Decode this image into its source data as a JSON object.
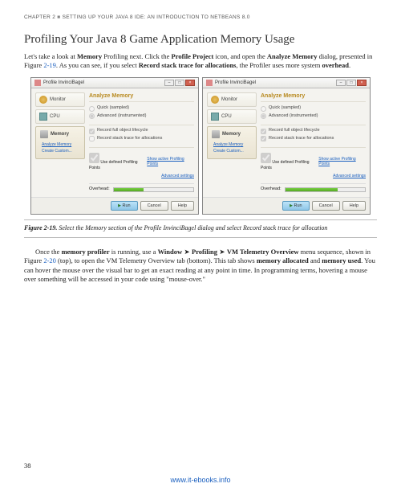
{
  "chapter_header": {
    "prefix": "CHAPTER 2",
    "sep": "■",
    "title": "SETTING UP YOUR JAVA 8 IDE: AN INTRODUCTION TO NETBEANS 8.0"
  },
  "section_title": "Profiling Your Java 8 Game Application Memory Usage",
  "para1": {
    "t1": "Let's take a look at ",
    "b1": "Memory",
    "t2": " Profiling next. Click the ",
    "b2": "Profile Project",
    "t3": " icon, and open the ",
    "b3": "Analyze Memory",
    "t4": " dialog, presented in Figure ",
    "xref": "2-19",
    "t5": ". As you can see, if you select ",
    "b4": "Record stack trace for allocations",
    "t6": ", the Profiler uses more system ",
    "b5": "overhead",
    "t7": "."
  },
  "dialog": {
    "title": "Profile InvinciBagel",
    "nav": {
      "monitor": "Monitor",
      "cpu": "CPU",
      "memory": "Memory",
      "sub_analyze": "Analyze Memory",
      "sub_create": "Create Custom..."
    },
    "pane_title": "Analyze Memory",
    "radio_quick": "Quick (sampled)",
    "radio_adv": "Advanced (instrumented)",
    "chk_lifecycle": "Record full object lifecycle",
    "chk_stack": "Record stack trace for allocations",
    "chk_ppoints": "Use defined Profiling Points",
    "ppoints_link": "Show active Profiling Points",
    "adv_link": "Advanced settings",
    "overhead_label": "Overhead:",
    "btn_run": "Run",
    "btn_cancel": "Cancel",
    "btn_help": "Help"
  },
  "left_overhead_pct": 38,
  "right_overhead_pct": 66,
  "figure_caption": {
    "num": "Figure 2-19.",
    "text": "Select the Memory section of the Profile InvinciBagel dialog and select Record stack trace for allocation"
  },
  "para2": {
    "t1": "Once the ",
    "b1": "memory profiler",
    "t2": " is running, use a ",
    "b2": "Window",
    "arrow": " ➤ ",
    "b3": "Profiling",
    "b4": "VM Telemetry Overview",
    "t3": " menu sequence, shown in Figure ",
    "xref": "2-20",
    "t4": " (top), to open the VM Telemetry Overview tab (bottom). This tab shows ",
    "b5": "memory allocated",
    "t5": " and ",
    "b6": "memory used",
    "t6": ". You can hover the mouse over the visual bar to get an exact reading at any point in time. In programming terms, hovering a mouse over something will be accessed in your code using \"mouse-over.\""
  },
  "page_number": "38",
  "footer_url": "www.it-ebooks.info"
}
